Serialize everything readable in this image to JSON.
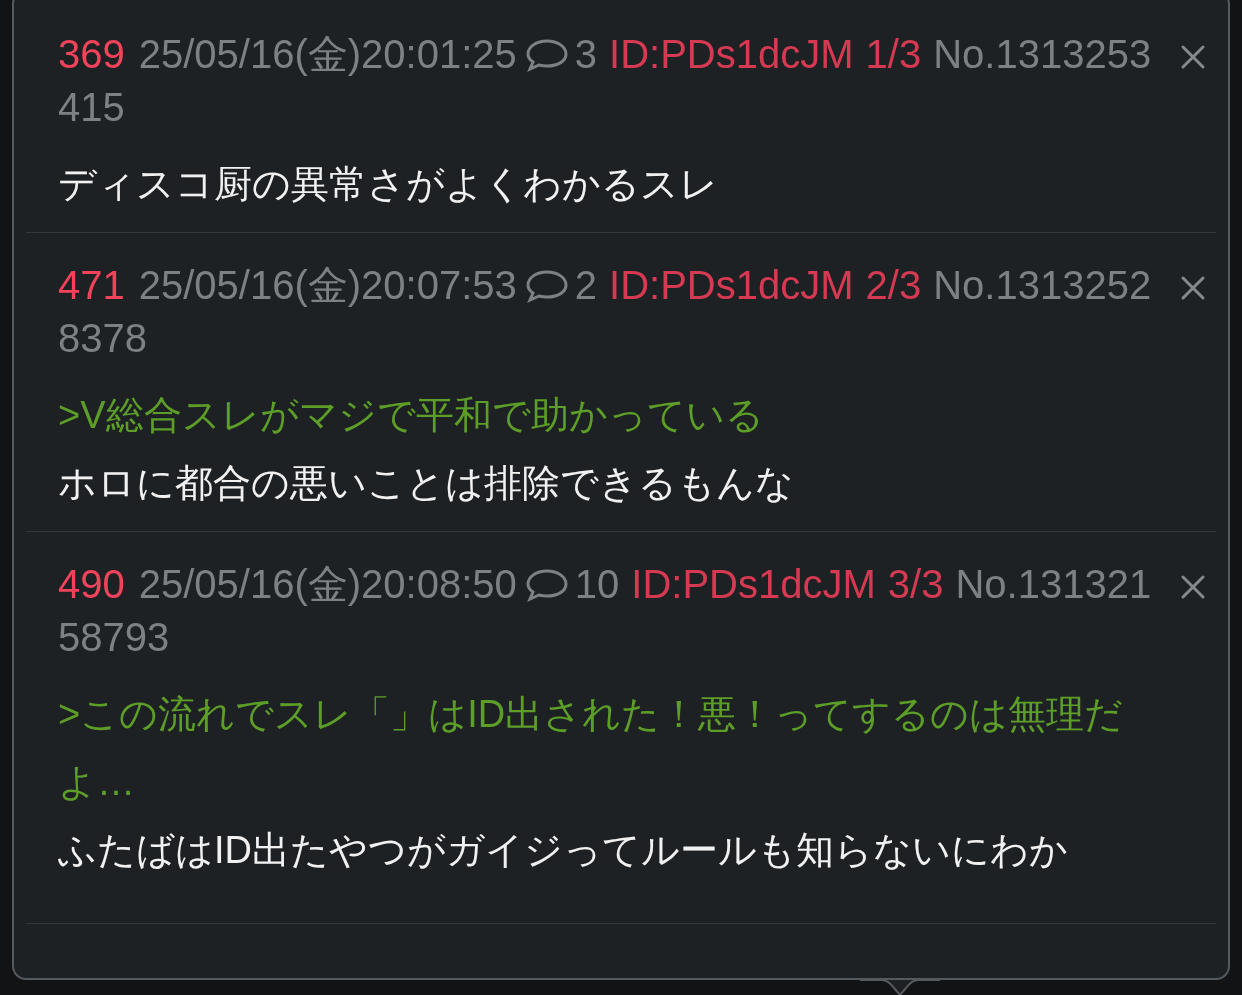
{
  "posts": [
    {
      "number": "369",
      "date": "25/05/16(金)20:01:25",
      "replies": "3",
      "id": "ID:PDs1dcJM",
      "id_count": "1/3",
      "post_no": "No.1313253",
      "post_no_cont": "415",
      "lines": [
        {
          "kind": "text",
          "text": "ディスコ厨の異常さがよくわかるスレ"
        }
      ]
    },
    {
      "number": "471",
      "date": "25/05/16(金)20:07:53",
      "replies": "2",
      "id": "ID:PDs1dcJM",
      "id_count": "2/3",
      "post_no": "No.1313252",
      "post_no_cont": "8378",
      "lines": [
        {
          "kind": "quote",
          "text": ">V総合スレがマジで平和で助かっている"
        },
        {
          "kind": "text",
          "text": "ホロに都合の悪いことは排除できるもんな"
        }
      ]
    },
    {
      "number": "490",
      "date": "25/05/16(金)20:08:50",
      "replies": "10",
      "id": "ID:PDs1dcJM",
      "id_count": "3/3",
      "post_no": "No.131321",
      "post_no_cont": "58793",
      "lines": [
        {
          "kind": "quote",
          "text": ">この流れでスレ「」はID出された！悪！ってするのは無理だよ…"
        },
        {
          "kind": "text",
          "text": "ふたばはID出たやつがガイジってルールも知らないにわか"
        }
      ]
    }
  ]
}
